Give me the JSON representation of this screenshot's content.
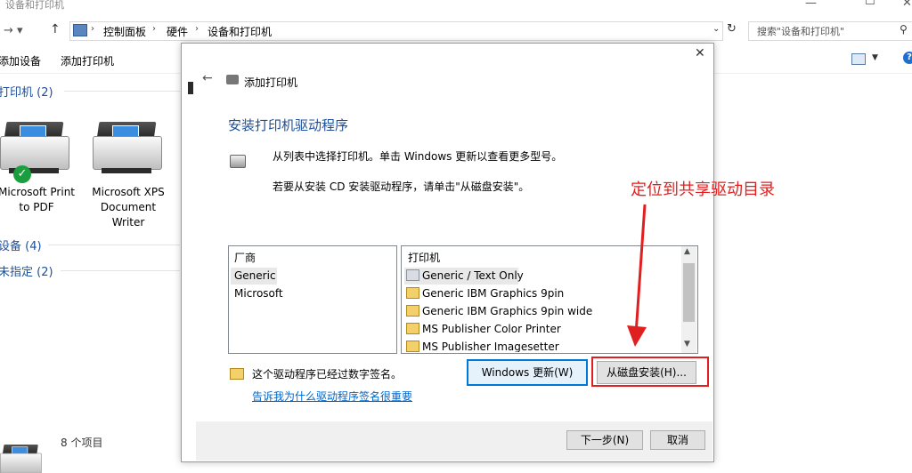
{
  "window": {
    "title": "设备和打印机"
  },
  "address": {
    "crumbs": [
      "控制面板",
      "硬件",
      "设备和打印机"
    ],
    "search_placeholder": "搜索\"设备和打印机\""
  },
  "toolbar": {
    "add_device": "添加设备",
    "add_printer": "添加打印机"
  },
  "groups": {
    "printers": "打印机 (2)",
    "devices": "设备 (4)",
    "unspecified": "未指定 (2)"
  },
  "printers": [
    {
      "label": "Microsoft Print\nto PDF"
    },
    {
      "label": "Microsoft XPS\nDocument\nWriter"
    }
  ],
  "status": {
    "count": "8 个项目"
  },
  "dialog": {
    "title": "添加打印机",
    "heading": "安装打印机驱动程序",
    "intro1": "从列表中选择打印机。单击 Windows 更新以查看更多型号。",
    "intro2": "若要从安装 CD 安装驱动程序，请单击\"从磁盘安装\"。",
    "manufacturer_header": "厂商",
    "manufacturers": [
      "Generic",
      "Microsoft"
    ],
    "printer_header": "打印机",
    "printer_models": [
      "Generic / Text Only",
      "Generic IBM Graphics 9pin",
      "Generic IBM Graphics 9pin wide",
      "MS Publisher Color Printer",
      "MS Publisher Imagesetter"
    ],
    "signed_text": "这个驱动程序已经过数字签名。",
    "signed_link": "告诉我为什么驱动程序签名很重要",
    "windows_update_btn": "Windows 更新(W)",
    "have_disk_btn": "从磁盘安装(H)...",
    "next_btn": "下一步(N)",
    "cancel_btn": "取消"
  },
  "annotation": {
    "text": "定位到共享驱动目录",
    "color": "#e02020"
  },
  "colors": {
    "accent": "#0078d7",
    "heading": "#1e4f9a",
    "link": "#0066cc"
  }
}
